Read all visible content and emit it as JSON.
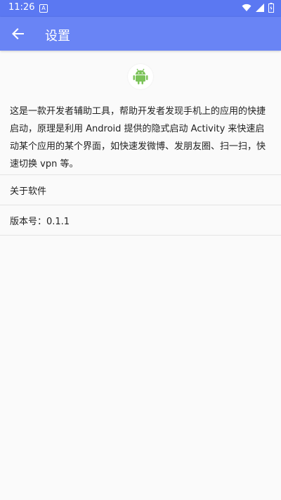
{
  "status_bar": {
    "time": "11:26",
    "notification_icon_letter": "A",
    "icons": [
      "notification-a-icon",
      "wifi-icon",
      "signal-icon",
      "battery-icon"
    ]
  },
  "app_bar": {
    "title": "设置",
    "back_icon": "arrow-back-icon",
    "background_color": "#6984f5"
  },
  "logo": {
    "icon": "android-robot-icon",
    "color": "#7cc35a"
  },
  "description": "这是一款开发者辅助工具，帮助开发者发现手机上的应用的快捷启动，原理是利用 Android 提供的隐式启动 Activity 来快速启动某个应用的某个界面，如快速发微博、发朋友圈、扫一扫，快速切换 vpn 等。",
  "items": [
    {
      "label": "关于软件"
    },
    {
      "label": "版本号：0.1.1"
    }
  ]
}
